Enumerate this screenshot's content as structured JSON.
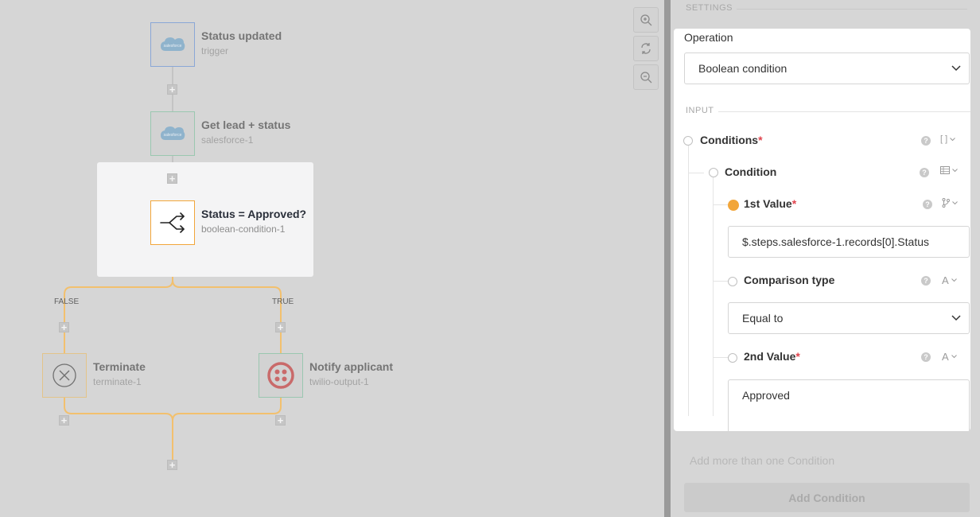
{
  "canvas": {
    "nodes": [
      {
        "id": "status-updated",
        "title": "Status updated",
        "subtitle": "trigger",
        "icon": "salesforce-cloud-icon",
        "icon_text": "salesforce"
      },
      {
        "id": "get-lead",
        "title": "Get lead + status",
        "subtitle": "salesforce-1",
        "icon": "salesforce-cloud-icon",
        "icon_text": "salesforce"
      },
      {
        "id": "boolean",
        "title": "Status = Approved?",
        "subtitle": "boolean-condition-1",
        "icon": "branch-split-icon"
      },
      {
        "id": "terminate",
        "title": "Terminate",
        "subtitle": "terminate-1",
        "icon": "close-circle-icon"
      },
      {
        "id": "notify",
        "title": "Notify applicant",
        "subtitle": "twilio-output-1",
        "icon": "twilio-icon"
      }
    ],
    "branches": {
      "false_label": "FALSE",
      "true_label": "TRUE"
    },
    "add_step_symbol": "+",
    "zoom_controls": [
      "zoom-in-icon",
      "reset-view-icon",
      "zoom-out-icon"
    ]
  },
  "panel": {
    "settings_header": "SETTINGS",
    "operation_label": "Operation",
    "operation_value": "Boolean condition",
    "input_header": "INPUT",
    "conditions_label": "Conditions",
    "condition_label": "Condition",
    "first_value_label": "1st Value",
    "first_value": "$.steps.salesforce-1.records[0].Status",
    "comparison_label": "Comparison type",
    "comparison_value": "Equal to",
    "second_value_label": "2nd Value",
    "second_value": "Approved",
    "required_mark": "*",
    "help_mark": "?",
    "add_more_hint": "Add more than one Condition",
    "add_condition_button": "Add Condition"
  },
  "colors": {
    "accent_orange": "#f2a63a",
    "salesforce_blue": "#5aa7d9",
    "twilio_red": "#d94a4a",
    "required_red": "#e0434d"
  }
}
